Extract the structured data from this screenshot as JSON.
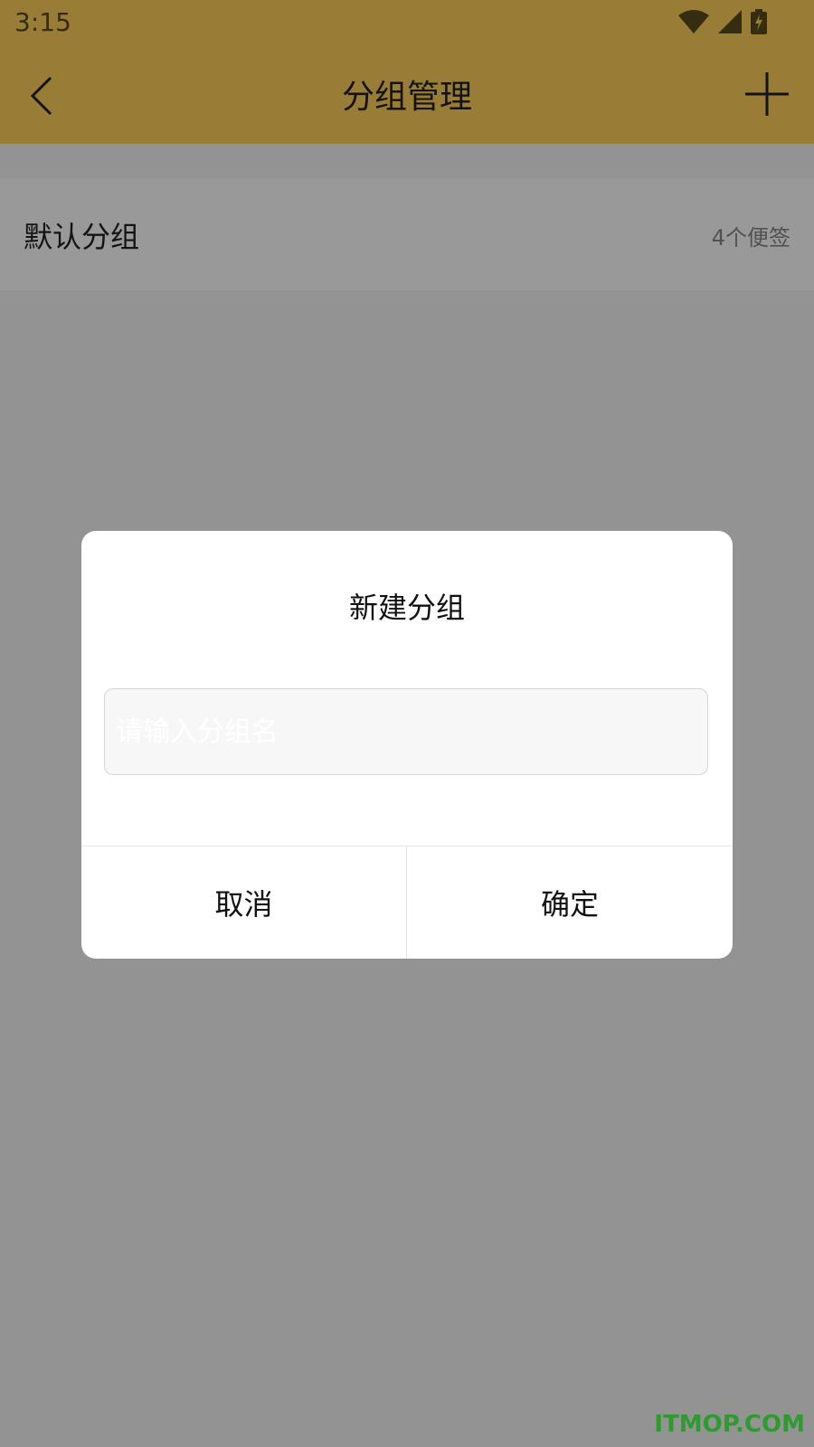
{
  "status_bar": {
    "time": "3:15",
    "icons": [
      "wifi-icon",
      "signal-icon",
      "battery-charging-icon"
    ]
  },
  "app_bar": {
    "title": "分组管理",
    "back_icon": "chevron-left-icon",
    "add_icon": "plus-icon"
  },
  "groups": [
    {
      "name": "默认分组",
      "count": "4个便签"
    }
  ],
  "dialog": {
    "title": "新建分组",
    "input": {
      "placeholder": "请输入分组名",
      "value": ""
    },
    "cancel_label": "取消",
    "confirm_label": "确定"
  },
  "watermark": "ITMOP.COM",
  "colors": {
    "accent": "#ffd15b",
    "overlay": "rgba(0,0,0,0.40)"
  }
}
